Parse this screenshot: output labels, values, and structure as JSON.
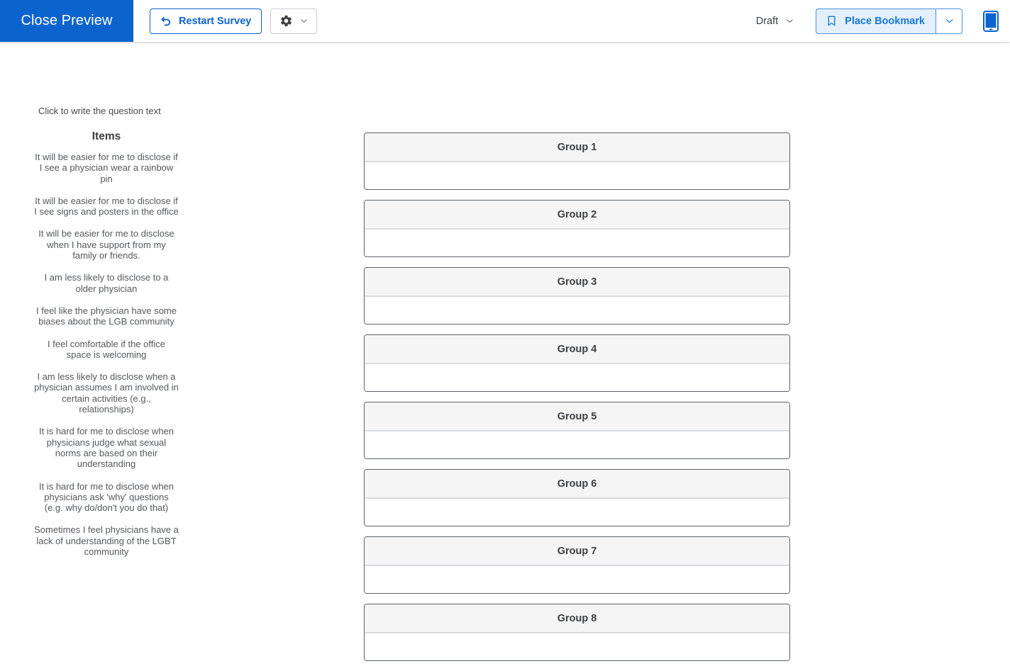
{
  "toolbar": {
    "close_preview_label": "Close Preview",
    "restart_survey_label": "Restart Survey",
    "restart_icon": "undo-arrow-icon",
    "gear_icon": "gear-icon",
    "gear_caret_icon": "chevron-down-icon",
    "draft_label": "Draft",
    "draft_caret_icon": "chevron-down-icon",
    "bookmark_label": "Place Bookmark",
    "bookmark_icon": "bookmark-icon",
    "bookmark_caret_icon": "chevron-down-icon",
    "device_icon": "tablet-device-icon",
    "accent_color": "#0b63ce",
    "bookmark_bg_color": "#e3f0fb"
  },
  "survey": {
    "question_placeholder": "Click to write the question text",
    "items_heading": "Items",
    "items": [
      "It will be easier for me to disclose if I see a physician wear a rainbow pin",
      "It will be easier for me to disclose if I see signs and posters in the office",
      "It will be easier for me to disclose when I have support from my family or friends.",
      "I am less likely to disclose to a older physician",
      "I feel like the physician have some biases about the LGB community",
      "I feel comfortable if the office space is welcoming",
      "I am less likely to disclose when a physician assumes I am involved in certain activities (e.g., relationships)",
      "It is hard for me to disclose when physicians judge what sexual norms are based on their understanding",
      "It is hard for me to disclose when physicians ask 'why' questions (e.g. why do/don't you do that)",
      "Sometimes I feel physicians have a lack of understanding of the LGBT community"
    ],
    "groups": [
      {
        "label": "Group 1"
      },
      {
        "label": "Group 2"
      },
      {
        "label": "Group 3"
      },
      {
        "label": "Group 4"
      },
      {
        "label": "Group 5"
      },
      {
        "label": "Group 6"
      },
      {
        "label": "Group 7"
      },
      {
        "label": "Group 8"
      }
    ]
  }
}
